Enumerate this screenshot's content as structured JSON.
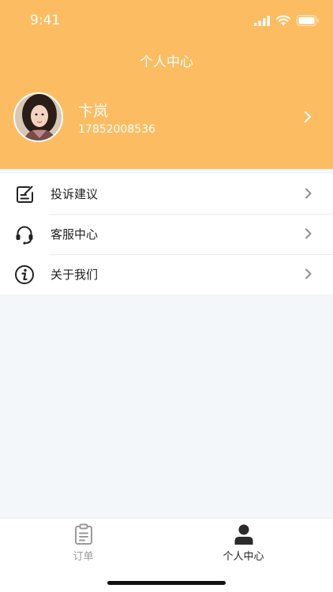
{
  "status_bar": {
    "time": "9:41",
    "icons": [
      "signal-icon",
      "wifi-icon",
      "battery-icon"
    ]
  },
  "header": {
    "title": "个人中心",
    "background_color": "#fcbd62"
  },
  "profile": {
    "name": "卞岚",
    "phone": "17852008536",
    "avatar_icon": "user-photo"
  },
  "menu": {
    "items": [
      {
        "label": "投诉建议",
        "icon": "edit-note-icon"
      },
      {
        "label": "客服中心",
        "icon": "headset-icon"
      },
      {
        "label": "关于我们",
        "icon": "info-icon"
      }
    ]
  },
  "tabbar": {
    "tabs": [
      {
        "label": "订单",
        "icon": "clipboard-icon",
        "active": false
      },
      {
        "label": "个人中心",
        "icon": "person-icon",
        "active": true
      }
    ]
  }
}
